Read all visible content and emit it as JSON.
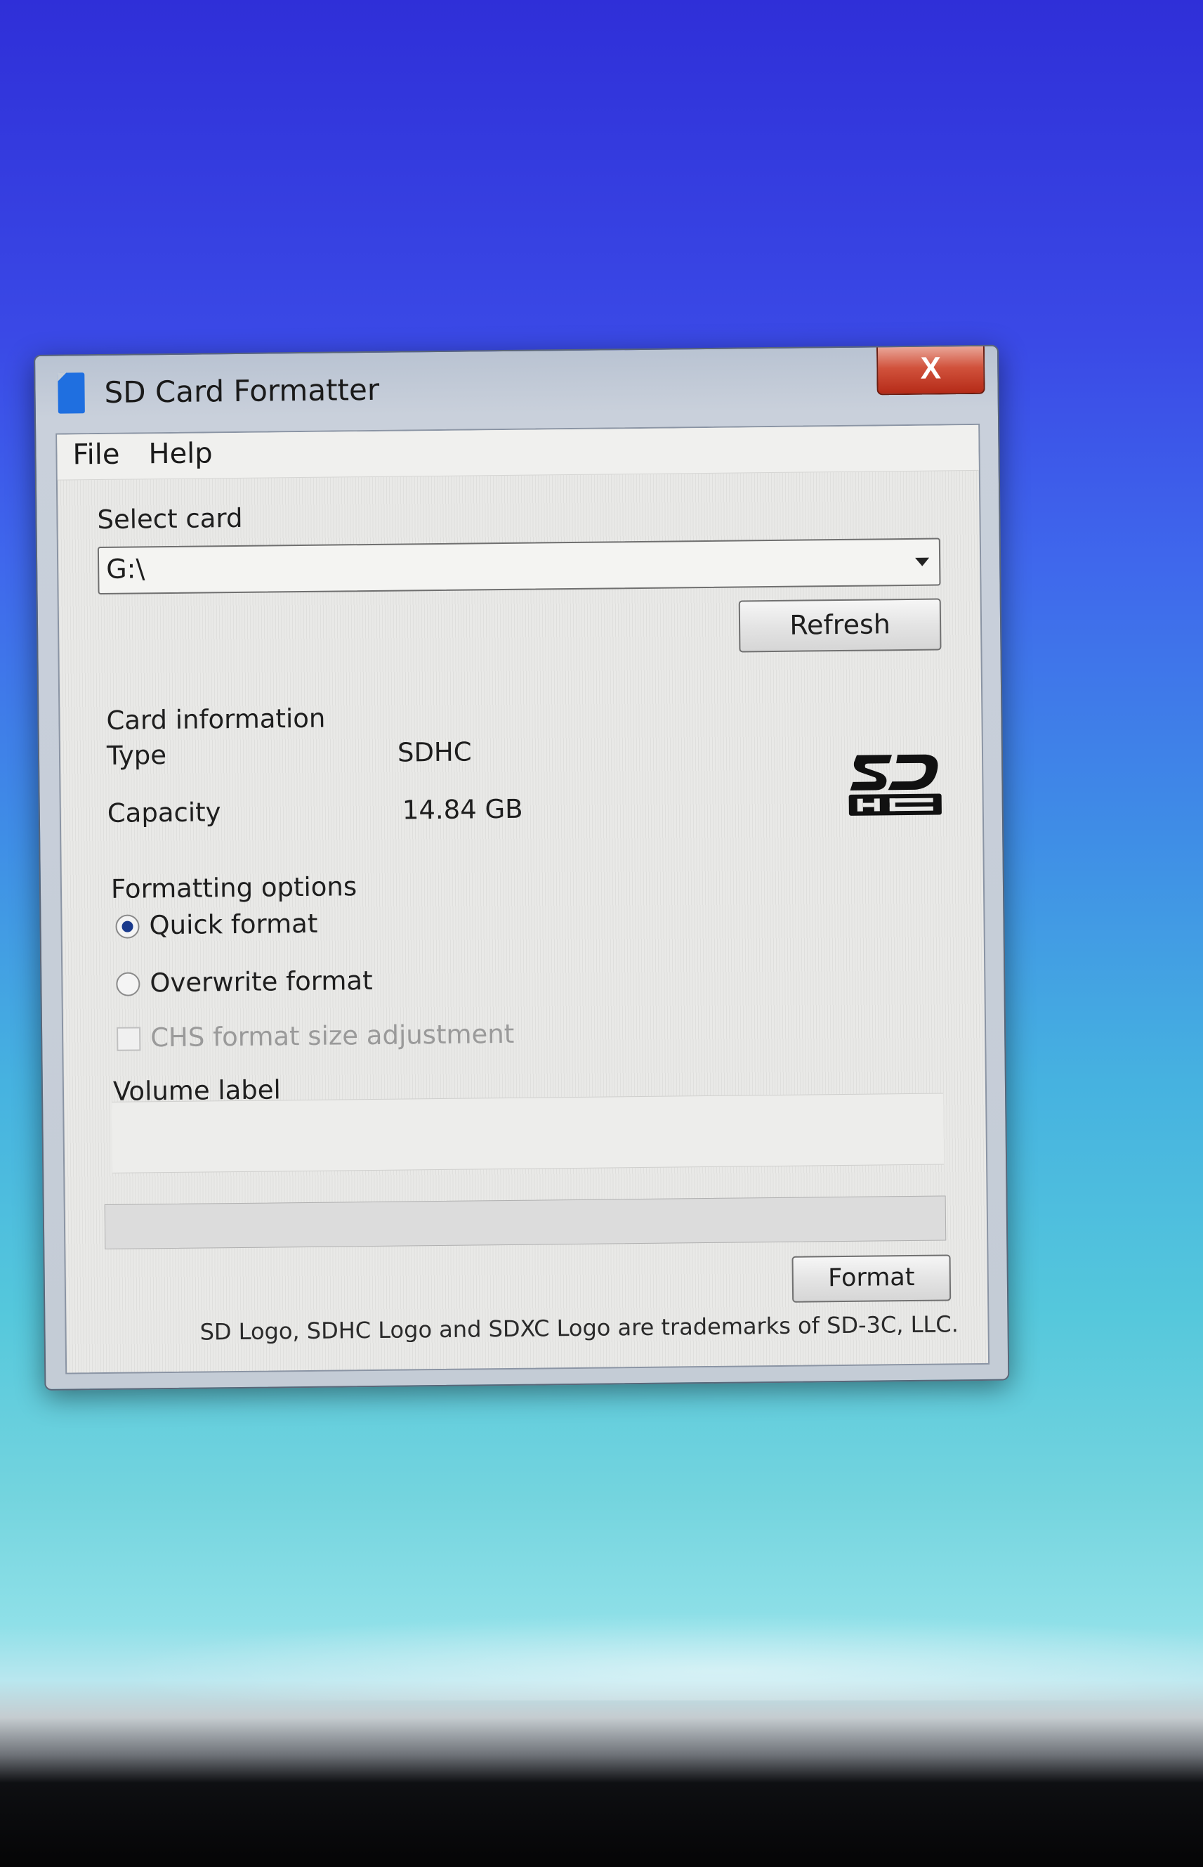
{
  "window": {
    "title": "SD Card Formatter",
    "close_label": "X"
  },
  "menu": {
    "items": [
      "File",
      "Help"
    ]
  },
  "select_card": {
    "label": "Select card",
    "value": "G:\\",
    "refresh_label": "Refresh"
  },
  "card_info": {
    "heading": "Card information",
    "type_label": "Type",
    "type_value": "SDHC",
    "capacity_label": "Capacity",
    "capacity_value": "14.84 GB"
  },
  "formatting_options": {
    "heading": "Formatting options",
    "quick_label": "Quick format",
    "overwrite_label": "Overwrite format",
    "chs_label": "CHS format size adjustment",
    "selected": "quick"
  },
  "volume": {
    "label": "Volume label",
    "value": ""
  },
  "progress": {
    "fraction": 0
  },
  "actions": {
    "format_label": "Format"
  },
  "footer": {
    "trademark": "SD Logo, SDHC Logo and SDXC Logo are trademarks of SD-3C, LLC."
  },
  "colors": {
    "close_button": "#c83a24",
    "radio_dot": "#1a3a8c",
    "app_icon": "#1f6fe0"
  }
}
